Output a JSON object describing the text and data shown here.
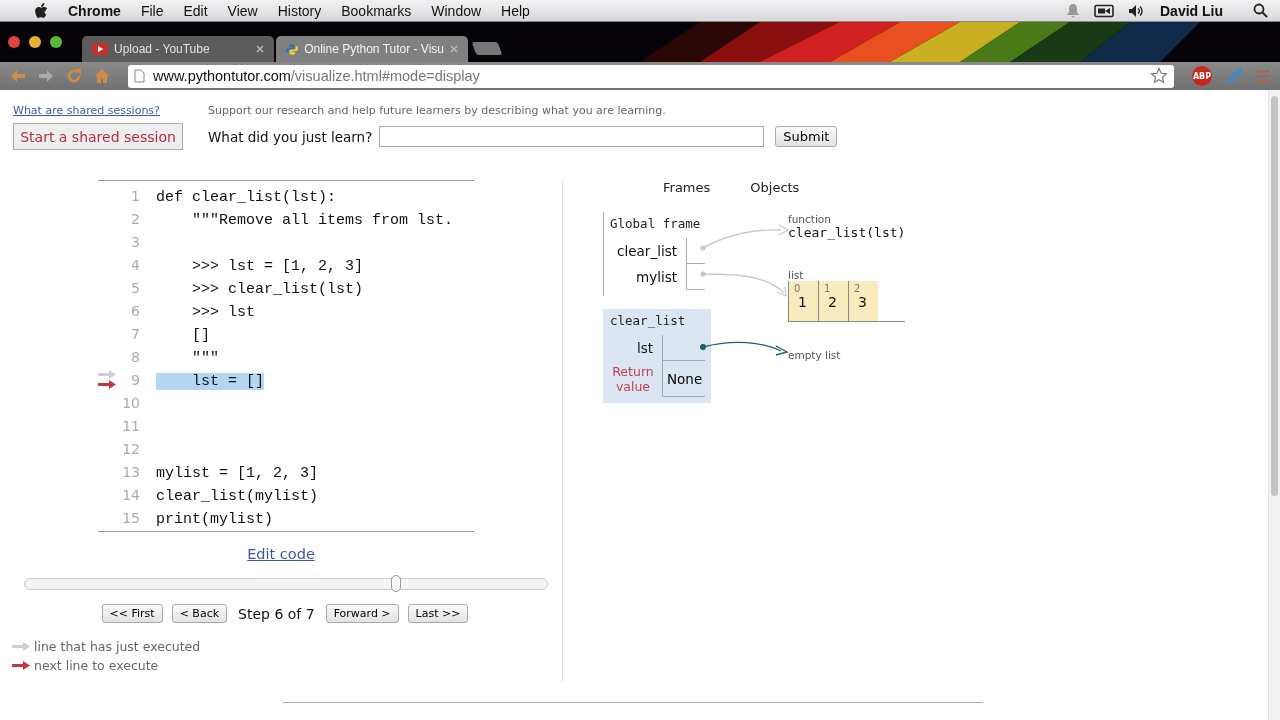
{
  "menu_bar": {
    "app": "Chrome",
    "items": [
      "File",
      "Edit",
      "View",
      "History",
      "Bookmarks",
      "Window",
      "Help"
    ],
    "user": "David Liu"
  },
  "tabs": [
    {
      "label": "Upload - YouTube",
      "selected": false,
      "kind": "youtube"
    },
    {
      "label": "Online Python Tutor - Visu",
      "selected": true,
      "kind": "python"
    }
  ],
  "address": {
    "host": "www.pythontutor.com",
    "path": "/visualize.html#mode=display"
  },
  "extensions": {
    "adblock": "ABP"
  },
  "header": {
    "shared_link": "What are shared sessions?",
    "start_button": "Start a shared session",
    "support_text": "Support our research and help future learners by describing what you are learning.",
    "learn_label": "What did you just learn?",
    "submit": "Submit"
  },
  "code": [
    {
      "number": "1",
      "text": "def clear_list(lst):",
      "highlighted": false,
      "just_executed": false,
      "next": false
    },
    {
      "number": "2",
      "text": "    \"\"\"Remove all items from lst.",
      "highlighted": false,
      "just_executed": false,
      "next": false
    },
    {
      "number": "3",
      "highlighted": false,
      "just_executed": false,
      "next": false
    },
    {
      "number": "4",
      "text": "    >>> lst = [1, 2, 3]",
      "highlighted": false,
      "just_executed": false,
      "next": false
    },
    {
      "number": "5",
      "text": "    >>> clear_list(lst)",
      "highlighted": false,
      "just_executed": false,
      "next": false
    },
    {
      "number": "6",
      "text": "    >>> lst",
      "highlighted": false,
      "just_executed": false,
      "next": false
    },
    {
      "number": "7",
      "text": "    []",
      "highlighted": false,
      "just_executed": false,
      "next": false
    },
    {
      "number": "8",
      "text": "    \"\"\"",
      "highlighted": false,
      "just_executed": false,
      "next": false
    },
    {
      "number": "9",
      "text": "    lst = []",
      "highlighted": true,
      "just_executed": true,
      "next": true
    },
    {
      "number": "10",
      "highlighted": false,
      "just_executed": false,
      "next": false
    },
    {
      "number": "11",
      "highlighted": false,
      "just_executed": false,
      "next": false
    },
    {
      "number": "12",
      "highlighted": false,
      "just_executed": false,
      "next": false
    },
    {
      "number": "13",
      "text": "mylist = [1, 2, 3]",
      "highlighted": false,
      "just_executed": false,
      "next": false
    },
    {
      "number": "14",
      "text": "clear_list(mylist)",
      "highlighted": false,
      "just_executed": false,
      "next": false
    },
    {
      "number": "15",
      "text": "print(mylist)",
      "highlighted": false,
      "just_executed": false,
      "next": false
    }
  ],
  "edit_link": "Edit code",
  "slider": {
    "level": 0.71
  },
  "navigation": {
    "buttons_before": [
      "<< First",
      "< Back"
    ],
    "step": "Step 6 of 7",
    "buttons_after": [
      "Forward >",
      "Last >>"
    ]
  },
  "legend": [
    {
      "kind": "just_executed",
      "text": "line that has just executed"
    },
    {
      "kind": "next",
      "text": "next line to execute"
    }
  ],
  "visualization": {
    "frames_heading": "Frames",
    "objects_heading": "Objects",
    "frames": [
      {
        "name": "Global frame",
        "active": false,
        "variables": [
          {
            "name": "clear_list",
            "kind": "pointer"
          },
          {
            "name": "mylist",
            "kind": "pointer"
          }
        ]
      },
      {
        "name": "clear_list",
        "active": true,
        "variables": [
          {
            "name": "lst",
            "kind": "pointer"
          },
          {
            "name": "Return value",
            "kind": "return",
            "value": "None"
          }
        ]
      }
    ],
    "objects": [
      {
        "kind": "function",
        "type_label": "function",
        "text": "clear_list(lst)"
      },
      {
        "kind": "list",
        "type_label": "list",
        "items": [
          {
            "index": "0",
            "value": "1"
          },
          {
            "index": "1",
            "value": "2"
          },
          {
            "index": "2",
            "value": "3"
          }
        ]
      },
      {
        "kind": "empty_list",
        "text": "empty list"
      }
    ]
  }
}
